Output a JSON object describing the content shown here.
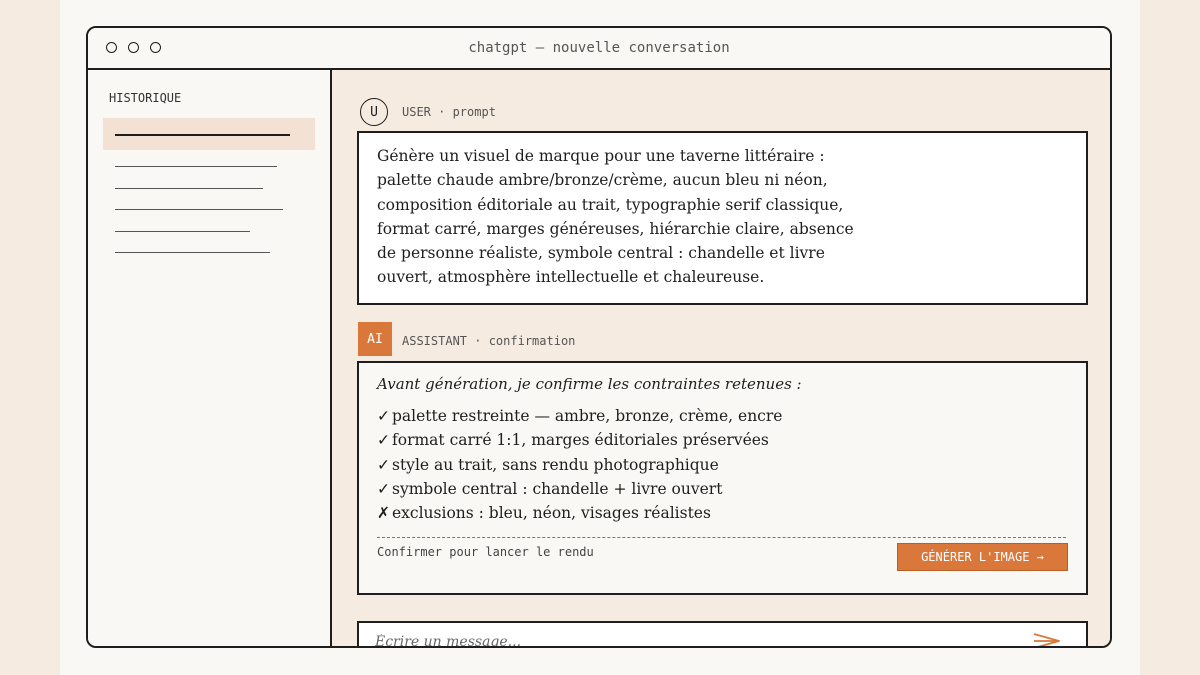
{
  "window": {
    "title": "chatgpt — nouvelle conversation"
  },
  "sidebar": {
    "heading": "HISTORIQUE",
    "items": [
      "",
      "",
      "",
      "",
      "",
      ""
    ]
  },
  "conversation": {
    "user": {
      "avatar": "U",
      "role": "USER · prompt",
      "lines": [
        "Génère un visuel de marque pour une taverne littéraire :",
        "palette chaude ambre/bronze/crème, aucun bleu ni néon,",
        "composition éditoriale au trait, typographie serif classique,",
        "format carré, marges généreuses, hiérarchie claire, absence",
        "de personne réaliste, symbole central : chandelle et livre",
        "ouvert, atmosphère intellectuelle et chaleureuse."
      ]
    },
    "assistant": {
      "avatar": "AI",
      "role": "ASSISTANT · confirmation",
      "intro": "Avant génération, je confirme les contraintes retenues :",
      "items": [
        {
          "mark": "✓",
          "text": "palette restreinte — ambre, bronze, crème, encre"
        },
        {
          "mark": "✓",
          "text": "format carré 1:1, marges éditoriales préservées"
        },
        {
          "mark": "✓",
          "text": "style au trait, sans rendu photographique"
        },
        {
          "mark": "✓",
          "text": "symbole central : chandelle + livre ouvert"
        },
        {
          "mark": "✗",
          "text": "exclusions : bleu, néon, visages réalistes"
        }
      ],
      "confirm_text": "Confirmer pour lancer le rendu",
      "button_label": "GÉNÉRER L'IMAGE →"
    }
  },
  "composer": {
    "placeholder": "Écrire un message...",
    "value": ""
  },
  "icons": {
    "send": "send-arrow-icon",
    "window_controls": "circle-icon"
  },
  "colors": {
    "accent": "#d9783a",
    "ink": "#1e1e1e",
    "cream": "#f6ebe0",
    "paper": "#faf8f4",
    "highlight": "#f3e1d3"
  }
}
